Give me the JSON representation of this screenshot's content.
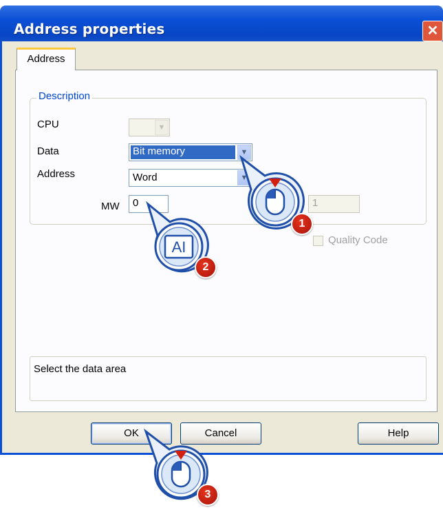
{
  "window": {
    "title": "Address properties",
    "close_symbol": "✕"
  },
  "tabs": [
    {
      "label": "Address"
    }
  ],
  "group": {
    "legend": "Description"
  },
  "fields": {
    "cpu_label": "CPU",
    "data_label": "Data",
    "data_value": "Bit memory",
    "address_label": "Address",
    "address_value": "Word",
    "mw_label": "MW",
    "mw_value": "0",
    "bit_value": "1",
    "quality_label": "Quality Code"
  },
  "description_text": "Select the data area",
  "buttons": {
    "ok": "OK",
    "cancel": "Cancel",
    "help": "Help"
  },
  "callouts": [
    {
      "number": "1",
      "icon": "mouse-click-icon"
    },
    {
      "number": "2",
      "icon": "text-input-icon",
      "glyph": "AI"
    },
    {
      "number": "3",
      "icon": "mouse-click-icon"
    }
  ],
  "colors": {
    "titlebar": "#0a4fd6",
    "legend": "#0046d5",
    "selection": "#316ac5",
    "badge": "#d3210f",
    "callout": "#1f4fa8"
  }
}
